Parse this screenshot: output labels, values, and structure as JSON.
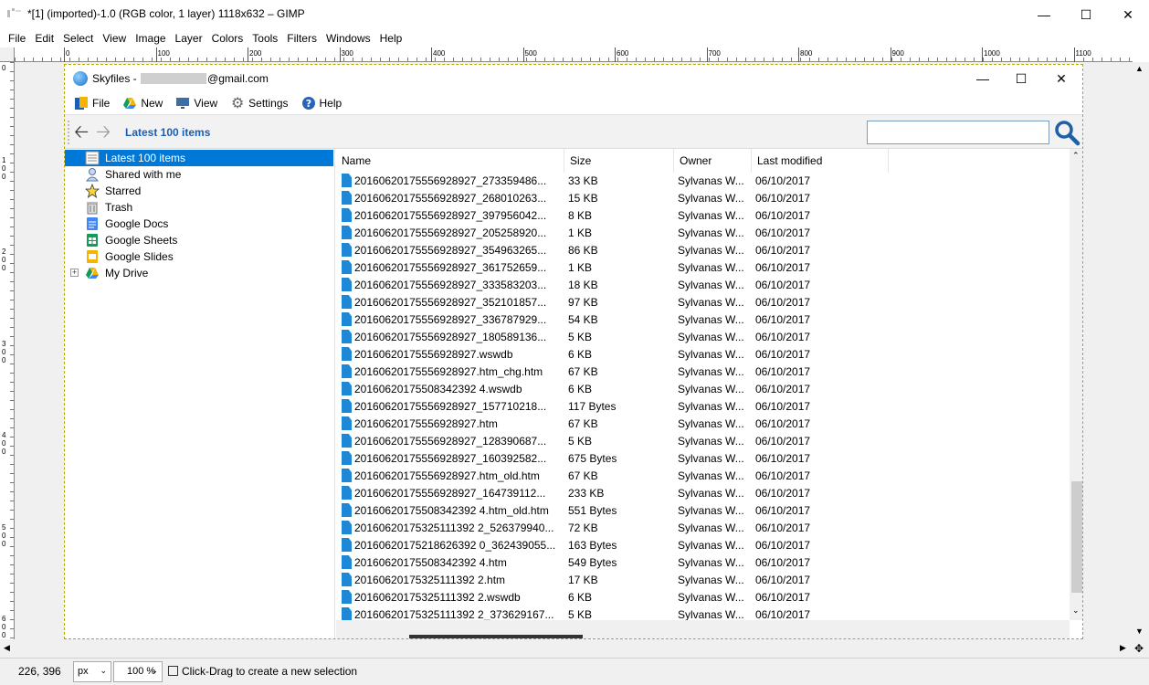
{
  "gimp": {
    "title": "*[1] (imported)-1.0 (RGB color, 1 layer) 1118x632 – GIMP",
    "menu": [
      "File",
      "Edit",
      "Select",
      "View",
      "Image",
      "Layer",
      "Colors",
      "Tools",
      "Filters",
      "Windows",
      "Help"
    ],
    "ruler_top": [
      "0",
      "100",
      "200",
      "300",
      "400",
      "500",
      "600",
      "700",
      "800",
      "900",
      "1000",
      "1100"
    ],
    "ruler_left": [
      "0",
      "1 0 0",
      "2 0 0",
      "3 0 0",
      "4 0 0",
      "5 0 0",
      "6 0 0"
    ],
    "status": {
      "coords": "226, 396",
      "unit": "px",
      "zoom": "100 %",
      "message": "Click-Drag to create a new selection"
    }
  },
  "skyfiles": {
    "title_prefix": "Skyfiles - ",
    "title_suffix": "@gmail.com",
    "menu": [
      {
        "label": "File",
        "icon": "file-menu-icon"
      },
      {
        "label": "New",
        "icon": "google-drive-icon"
      },
      {
        "label": "View",
        "icon": "monitor-icon"
      },
      {
        "label": "Settings",
        "icon": "gear-icon"
      },
      {
        "label": "Help",
        "icon": "help-icon"
      }
    ],
    "breadcrumb": "Latest 100 items",
    "search_placeholder": "",
    "tree": [
      {
        "label": "Latest 100 items",
        "icon": "list-icon",
        "selected": true
      },
      {
        "label": "Shared with me",
        "icon": "user-icon"
      },
      {
        "label": "Starred",
        "icon": "star-icon"
      },
      {
        "label": "Trash",
        "icon": "trash-icon"
      },
      {
        "label": "Google Docs",
        "icon": "google-docs-icon"
      },
      {
        "label": "Google Sheets",
        "icon": "google-sheets-icon"
      },
      {
        "label": "Google Slides",
        "icon": "google-slides-icon"
      },
      {
        "label": "My Drive",
        "icon": "google-drive-icon",
        "expandable": true
      }
    ],
    "columns": [
      "Name",
      "Size",
      "Owner",
      "Last modified"
    ],
    "rows": [
      [
        "20160620175556928927_273359486...",
        "33 KB",
        "Sylvanas W...",
        "06/10/2017"
      ],
      [
        "20160620175556928927_268010263...",
        "15 KB",
        "Sylvanas W...",
        "06/10/2017"
      ],
      [
        "20160620175556928927_397956042...",
        "8 KB",
        "Sylvanas W...",
        "06/10/2017"
      ],
      [
        "20160620175556928927_205258920...",
        "1 KB",
        "Sylvanas W...",
        "06/10/2017"
      ],
      [
        "20160620175556928927_354963265...",
        "86 KB",
        "Sylvanas W...",
        "06/10/2017"
      ],
      [
        "20160620175556928927_361752659...",
        "1 KB",
        "Sylvanas W...",
        "06/10/2017"
      ],
      [
        "20160620175556928927_333583203...",
        "18 KB",
        "Sylvanas W...",
        "06/10/2017"
      ],
      [
        "20160620175556928927_352101857...",
        "97 KB",
        "Sylvanas W...",
        "06/10/2017"
      ],
      [
        "20160620175556928927_336787929...",
        "54 KB",
        "Sylvanas W...",
        "06/10/2017"
      ],
      [
        "20160620175556928927_180589136...",
        "5 KB",
        "Sylvanas W...",
        "06/10/2017"
      ],
      [
        "20160620175556928927.wswdb",
        "6 KB",
        "Sylvanas W...",
        "06/10/2017"
      ],
      [
        "20160620175556928927.htm_chg.htm",
        "67 KB",
        "Sylvanas W...",
        "06/10/2017"
      ],
      [
        "20160620175508342392 4.wswdb",
        "6 KB",
        "Sylvanas W...",
        "06/10/2017"
      ],
      [
        "20160620175556928927_157710218...",
        "117 Bytes",
        "Sylvanas W...",
        "06/10/2017"
      ],
      [
        "20160620175556928927.htm",
        "67 KB",
        "Sylvanas W...",
        "06/10/2017"
      ],
      [
        "20160620175556928927_128390687...",
        "5 KB",
        "Sylvanas W...",
        "06/10/2017"
      ],
      [
        "20160620175556928927_160392582...",
        "675 Bytes",
        "Sylvanas W...",
        "06/10/2017"
      ],
      [
        "20160620175556928927.htm_old.htm",
        "67 KB",
        "Sylvanas W...",
        "06/10/2017"
      ],
      [
        "20160620175556928927_164739112...",
        "233 KB",
        "Sylvanas W...",
        "06/10/2017"
      ],
      [
        "20160620175508342392 4.htm_old.htm",
        "551 Bytes",
        "Sylvanas W...",
        "06/10/2017"
      ],
      [
        "20160620175325111392 2_526379940...",
        "72 KB",
        "Sylvanas W...",
        "06/10/2017"
      ],
      [
        "20160620175218626392 0_362439055...",
        "163 Bytes",
        "Sylvanas W...",
        "06/10/2017"
      ],
      [
        "20160620175508342392 4.htm",
        "549 Bytes",
        "Sylvanas W...",
        "06/10/2017"
      ],
      [
        "20160620175325111392 2.htm",
        "17 KB",
        "Sylvanas W...",
        "06/10/2017"
      ],
      [
        "20160620175325111392 2.wswdb",
        "6 KB",
        "Sylvanas W...",
        "06/10/2017"
      ],
      [
        "20160620175325111392 2_373629167...",
        "5 KB",
        "Sylvanas W...",
        "06/10/2017"
      ]
    ]
  },
  "colors": {
    "selection": "#0078d7",
    "file_icon": "#1e88d6",
    "breadcrumb": "#1a5fb4"
  }
}
